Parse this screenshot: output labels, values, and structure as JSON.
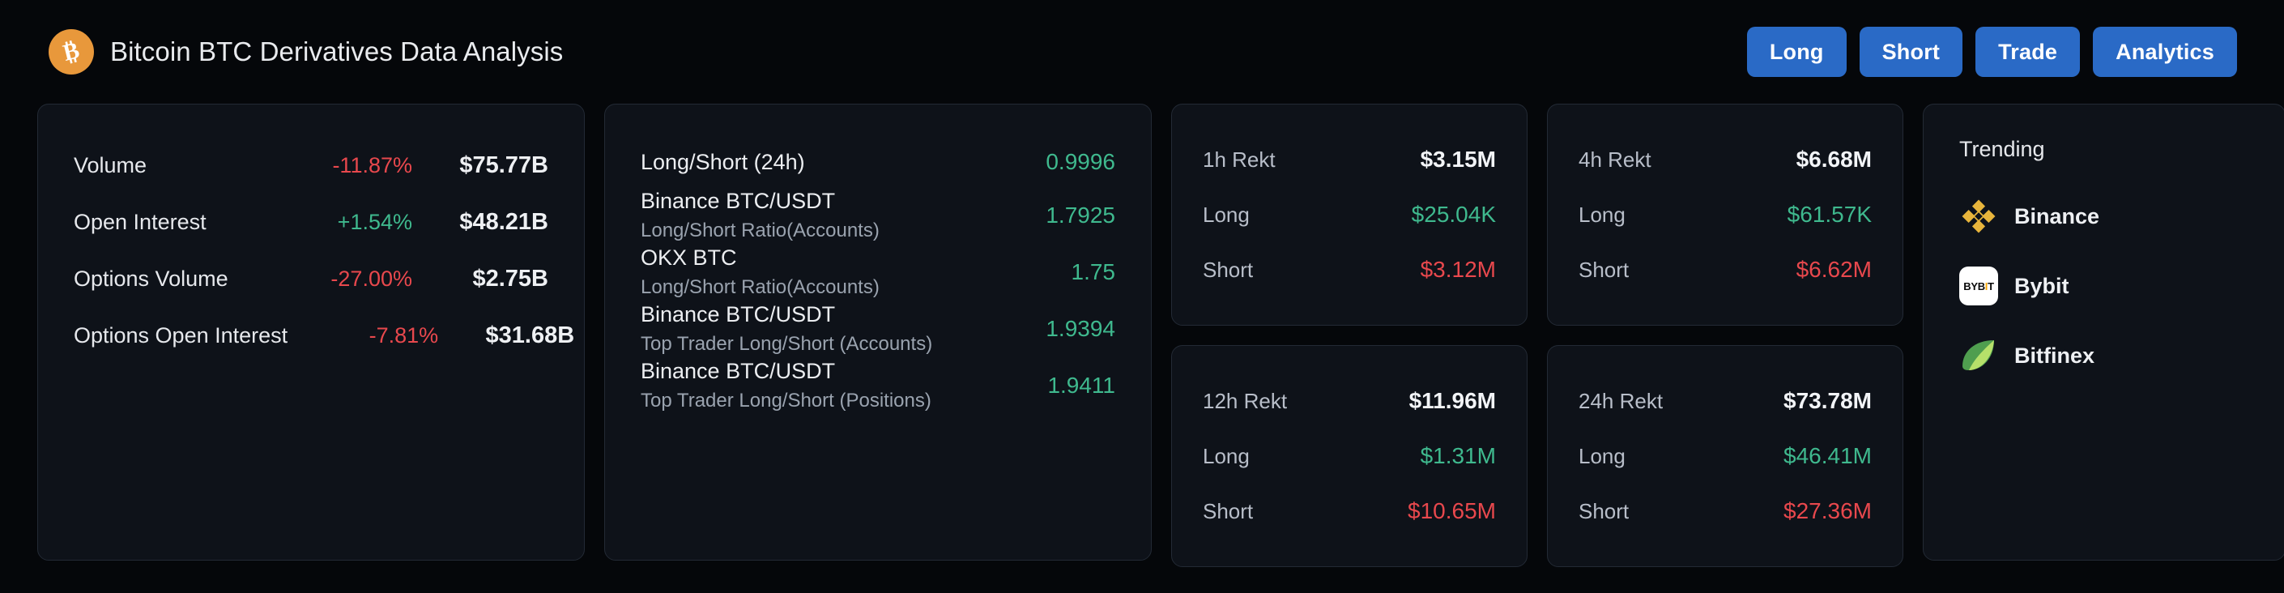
{
  "header": {
    "logo_icon": "bitcoin-icon",
    "title": "Bitcoin BTC Derivatives Data Analysis",
    "buttons": [
      {
        "label": "Long",
        "name": "long-button"
      },
      {
        "label": "Short",
        "name": "short-button"
      },
      {
        "label": "Trade",
        "name": "trade-button"
      },
      {
        "label": "Analytics",
        "name": "analytics-button"
      }
    ]
  },
  "metrics": [
    {
      "label": "Volume",
      "change": "-11.87%",
      "direction": "down",
      "value": "$75.77B"
    },
    {
      "label": "Open Interest",
      "change": "+1.54%",
      "direction": "up",
      "value": "$48.21B"
    },
    {
      "label": "Options Volume",
      "change": "-27.00%",
      "direction": "down",
      "value": "$2.75B"
    },
    {
      "label": "Options Open Interest",
      "change": "-7.81%",
      "direction": "down",
      "value": "$31.68B"
    }
  ],
  "ratios": [
    {
      "title": "Long/Short (24h)",
      "subtitle": "",
      "value": "0.9996"
    },
    {
      "title": "Binance BTC/USDT",
      "subtitle": "Long/Short Ratio(Accounts)",
      "value": "1.7925"
    },
    {
      "title": "OKX BTC",
      "subtitle": "Long/Short Ratio(Accounts)",
      "value": "1.75"
    },
    {
      "title": "Binance BTC/USDT",
      "subtitle": "Top Trader Long/Short (Accounts)",
      "value": "1.9394"
    },
    {
      "title": "Binance BTC/USDT",
      "subtitle": "Top Trader Long/Short (Positions)",
      "value": "1.9411"
    }
  ],
  "rekt": [
    {
      "period_label": "1h Rekt",
      "total": "$3.15M",
      "long_label": "Long",
      "long_value": "$25.04K",
      "short_label": "Short",
      "short_value": "$3.12M"
    },
    {
      "period_label": "4h Rekt",
      "total": "$6.68M",
      "long_label": "Long",
      "long_value": "$61.57K",
      "short_label": "Short",
      "short_value": "$6.62M"
    },
    {
      "period_label": "12h Rekt",
      "total": "$11.96M",
      "long_label": "Long",
      "long_value": "$1.31M",
      "short_label": "Short",
      "short_value": "$10.65M"
    },
    {
      "period_label": "24h Rekt",
      "total": "$73.78M",
      "long_label": "Long",
      "long_value": "$46.41M",
      "short_label": "Short",
      "short_value": "$27.36M"
    }
  ],
  "trending": {
    "title": "Trending",
    "items": [
      {
        "name": "Binance",
        "icon": "binance-logo-icon"
      },
      {
        "name": "Bybit",
        "icon": "bybit-logo-icon"
      },
      {
        "name": "Bitfinex",
        "icon": "bitfinex-logo-icon"
      }
    ]
  },
  "colors": {
    "accent_blue": "#2a6ac6",
    "positive_green": "#3fb98e",
    "negative_red": "#e8484d",
    "bitcoin_orange": "#e8983b",
    "binance_gold": "#e8b53c",
    "bybit_orange": "#f7a600",
    "bitfinex_green": "#5aa85a",
    "card_bg": "#0e1219",
    "page_bg": "#05070a"
  }
}
